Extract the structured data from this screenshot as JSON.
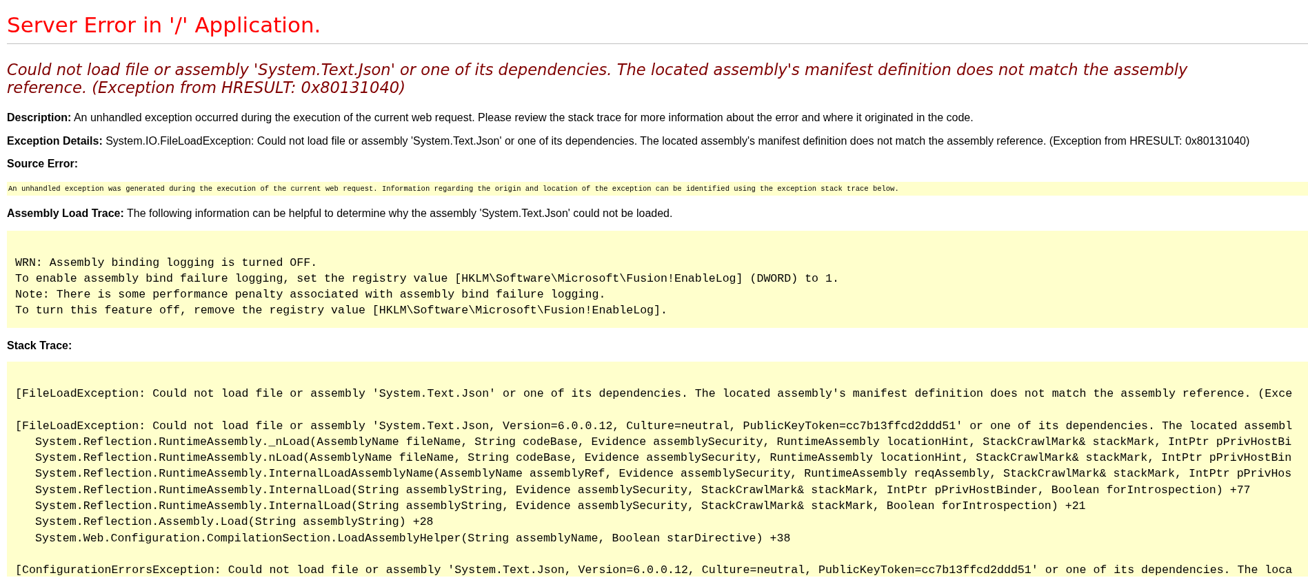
{
  "title": "Server Error in '/' Application.",
  "error_message": "Could not load file or assembly 'System.Text.Json' or one of its dependencies. The located assembly's manifest definition does not match the assembly reference. (Exception from HRESULT: 0x80131040)",
  "description": "**Description:** An unhandled exception occurred during the execution of the current web request. Please review the stack trace for more information about the error and where it originated in the code.",
  "exception_details": "**Exception Details:** System.IO.FileLoadException: Could not load file or assembly 'System.Text.Json' or one of its dependencies. The located assembly's manifest definition does not match the assembly reference. (Exception from HRESULT: 0x80131040)",
  "source_error": {
    "label": "Source Error:",
    "text": "An unhandled exception was generated during the execution of the current web request. Information regarding the origin and location of the exception can be identified using the exception stack trace below."
  },
  "assembly_load_trace": {
    "text": "**Assembly Load Trace:** The following information can be helpful to determine why the assembly 'System.Text.Json' could not be loaded.",
    "lines": [
      "WRN: Assembly binding logging is turned OFF.",
      "To enable assembly bind failure logging, set the registry value [HKLM\\Software\\Microsoft\\Fusion!EnableLog] (DWORD) to 1.",
      "Note: There is some performance penalty associated with assembly bind failure logging.",
      "To turn this feature off, remove the registry value [HKLM\\Software\\Microsoft\\Fusion!EnableLog]."
    ]
  },
  "stack_trace": {
    "label": "Stack Trace:",
    "exceptions": [
      {
        "message": "[FileLoadException: Could not load file or assembly 'System.Text.Json' or one of its dependencies. The located assembly's manifest definition does not match the assembly reference. (Exce"
      },
      {
        "message": "[FileLoadException: Could not load file or assembly 'System.Text.Json, Version=6.0.0.12, Culture=neutral, PublicKeyToken=cc7b13ffcd2ddd51' or one of its dependencies. The located assembl",
        "frames": [
          "System.Reflection.RuntimeAssembly._nLoad(AssemblyName fileName, String codeBase, Evidence assemblySecurity, RuntimeAssembly locationHint, StackCrawlMark& stackMark, IntPtr pPrivHostBi",
          "System.Reflection.RuntimeAssembly.nLoad(AssemblyName fileName, String codeBase, Evidence assemblySecurity, RuntimeAssembly locationHint, StackCrawlMark& stackMark, IntPtr pPrivHostBin",
          "System.Reflection.RuntimeAssembly.InternalLoadAssemblyName(AssemblyName assemblyRef, Evidence assemblySecurity, RuntimeAssembly reqAssembly, StackCrawlMark& stackMark, IntPtr pPrivHos",
          "System.Reflection.RuntimeAssembly.InternalLoad(String assemblyString, Evidence assemblySecurity, StackCrawlMark& stackMark, IntPtr pPrivHostBinder, Boolean forIntrospection) +77",
          "System.Reflection.RuntimeAssembly.InternalLoad(String assemblyString, Evidence assemblySecurity, StackCrawlMark& stackMark, Boolean forIntrospection) +21",
          "System.Reflection.Assembly.Load(String assemblyString) +28",
          "System.Web.Configuration.CompilationSection.LoadAssemblyHelper(String assemblyName, Boolean starDirective) +38"
        ]
      },
      {
        "message": "[ConfigurationErrorsException: Could not load file or assembly 'System.Text.Json, Version=6.0.0.12, Culture=neutral, PublicKeyToken=cc7b13ffcd2ddd51' or one of its dependencies. The loca"
      }
    ]
  }
}
